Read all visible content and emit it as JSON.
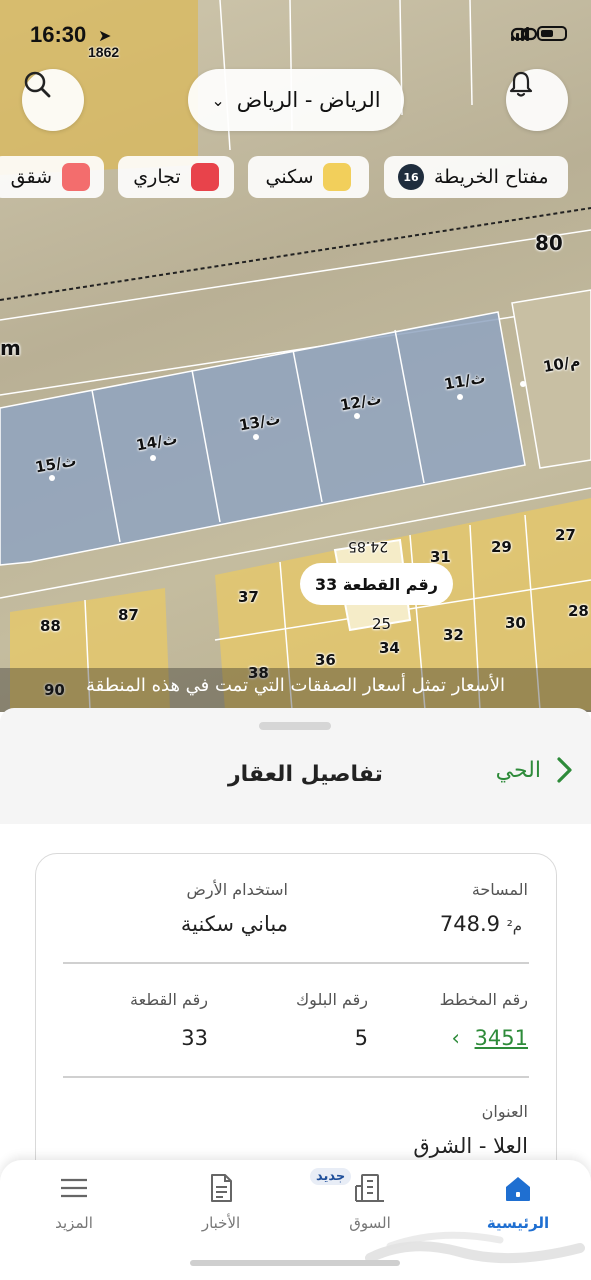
{
  "status_bar": {
    "time": "16:30",
    "time_sub": "1862"
  },
  "map": {
    "city_selector": "الرياض - الرياض",
    "legend_chips": [
      {
        "label": "مفتاح الخريطة",
        "badge": "16"
      },
      {
        "label": "سكني",
        "color": "#f2cf5b"
      },
      {
        "label": "تجاري",
        "color": "#e8434b"
      },
      {
        "label": "شقق",
        "color": "#f36d6d"
      }
    ],
    "street_width": "80",
    "street_label": "m",
    "block_plots": [
      "11/ث",
      "12/ث",
      "13/ث",
      "14/ث",
      "15/ث",
      "10/م"
    ],
    "plot_numbers": [
      "27",
      "28",
      "29",
      "30",
      "31",
      "32",
      "34",
      "25",
      "36",
      "37",
      "38",
      "87",
      "88",
      "90",
      "24.85"
    ],
    "selected_plot_callout": "رقم القطعة 33",
    "caption": "الأسعار تمثل أسعار الصفقات التي تمت في هذه المنطقة"
  },
  "sheet": {
    "title": "تفاصيل العقار",
    "back_label": "الحي",
    "area_label": "المساحة",
    "area_value": "748.9",
    "area_unit": "م²",
    "land_use_label": "استخدام الأرض",
    "land_use_value": "مباني سكنية",
    "plan_label": "رقم المخطط",
    "plan_value": "3451",
    "block_label": "رقم البلوك",
    "block_value": "5",
    "plot_label": "رقم القطعة",
    "plot_value": "33",
    "address_label": "العنوان",
    "address_value": "العلا - الشرق"
  },
  "tabbar": {
    "home": "الرئيسية",
    "market": "السوق",
    "market_badge": "جديد",
    "news": "الأخبار",
    "more": "المزيد"
  }
}
